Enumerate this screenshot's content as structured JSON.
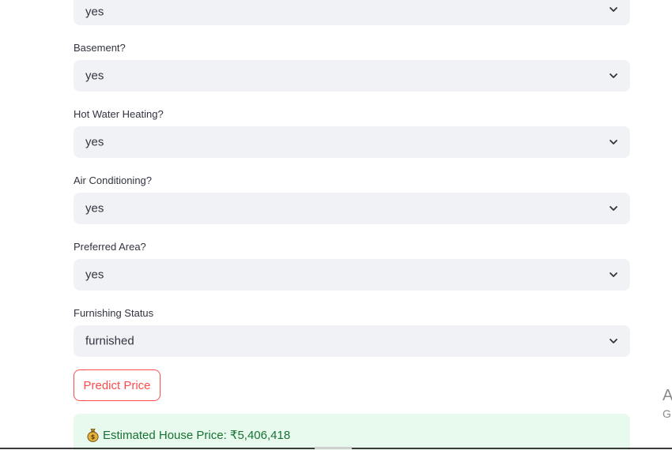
{
  "fields": [
    {
      "label": "",
      "value": "yes"
    },
    {
      "label": "Basement?",
      "value": "yes"
    },
    {
      "label": "Hot Water Heating?",
      "value": "yes"
    },
    {
      "label": "Air Conditioning?",
      "value": "yes"
    },
    {
      "label": "Preferred Area?",
      "value": "yes"
    },
    {
      "label": "Furnishing Status",
      "value": "furnished"
    }
  ],
  "predict_button": {
    "label": "Predict Price"
  },
  "result": {
    "icon": "money-bag-icon",
    "text": "Estimated House Price: ₹5,406,418"
  },
  "edge_overlay": {
    "line1": "A",
    "line2": "G"
  },
  "colors": {
    "select_bg": "#f0f2f6",
    "accent": "#ff4b4b",
    "success_bg": "#e8f9ee",
    "success_text": "#177233"
  }
}
